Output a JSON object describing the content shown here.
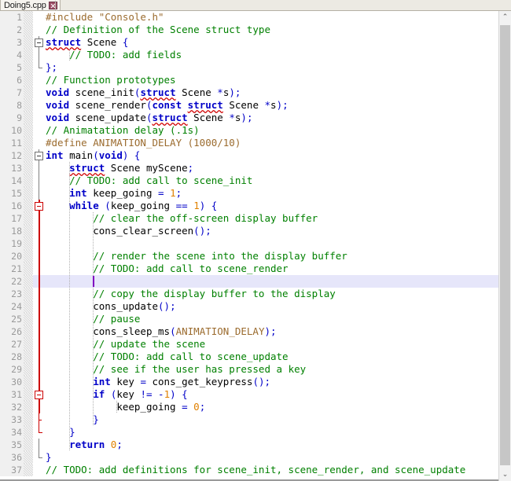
{
  "window": {
    "tab_label": "Doing5.cpp",
    "tab_icon": "close-icon"
  },
  "scrollbar": {
    "up_arrow": "⌃",
    "down_arrow": "⌄"
  },
  "editor": {
    "filename": "Doing5.cpp",
    "language": "C++",
    "current_line": 22,
    "total_lines": 37,
    "colors": {
      "keyword": "#0000c8",
      "comment": "#008000",
      "preprocessor": "#9b6b2e",
      "number": "#e08000",
      "current_line_bg": "#e6e6fa",
      "gutter_bg": "#f0f0f0",
      "fold_active": "#cc0000",
      "caret": "#8000c0"
    },
    "lines": [
      {
        "n": 1,
        "text": "#include \"Console.h\""
      },
      {
        "n": 2,
        "text": "// Definition of the Scene struct type"
      },
      {
        "n": 3,
        "text": "struct Scene {"
      },
      {
        "n": 4,
        "text": "    // TODO: add fields"
      },
      {
        "n": 5,
        "text": "};"
      },
      {
        "n": 6,
        "text": "// Function prototypes"
      },
      {
        "n": 7,
        "text": "void scene_init(struct Scene *s);"
      },
      {
        "n": 8,
        "text": "void scene_render(const struct Scene *s);"
      },
      {
        "n": 9,
        "text": "void scene_update(struct Scene *s);"
      },
      {
        "n": 10,
        "text": "// Animatation delay (.1s)"
      },
      {
        "n": 11,
        "text": "#define ANIMATION_DELAY (1000/10)"
      },
      {
        "n": 12,
        "text": "int main(void) {"
      },
      {
        "n": 13,
        "text": "    struct Scene myScene;"
      },
      {
        "n": 14,
        "text": "    // TODO: add call to scene_init"
      },
      {
        "n": 15,
        "text": "    int keep_going = 1;"
      },
      {
        "n": 16,
        "text": "    while (keep_going == 1) {"
      },
      {
        "n": 17,
        "text": "        // clear the off-screen display buffer"
      },
      {
        "n": 18,
        "text": "        cons_clear_screen();"
      },
      {
        "n": 19,
        "text": ""
      },
      {
        "n": 20,
        "text": "        // render the scene into the display buffer"
      },
      {
        "n": 21,
        "text": "        // TODO: add call to scene_render"
      },
      {
        "n": 22,
        "text": ""
      },
      {
        "n": 23,
        "text": "        // copy the display buffer to the display"
      },
      {
        "n": 24,
        "text": "        cons_update();"
      },
      {
        "n": 25,
        "text": "        // pause"
      },
      {
        "n": 26,
        "text": "        cons_sleep_ms(ANIMATION_DELAY);"
      },
      {
        "n": 27,
        "text": "        // update the scene"
      },
      {
        "n": 28,
        "text": "        // TODO: add call to scene_update"
      },
      {
        "n": 29,
        "text": "        // see if the user has pressed a key"
      },
      {
        "n": 30,
        "text": "        int key = cons_get_keypress();"
      },
      {
        "n": 31,
        "text": "        if (key != -1) {"
      },
      {
        "n": 32,
        "text": "            keep_going = 0;"
      },
      {
        "n": 33,
        "text": "        }"
      },
      {
        "n": 34,
        "text": "    }"
      },
      {
        "n": 35,
        "text": "    return 0;"
      },
      {
        "n": 36,
        "text": "}"
      },
      {
        "n": 37,
        "text": "// TODO: add definitions for scene_init, scene_render, and scene_update"
      }
    ],
    "spellcheck_words": [
      "struct",
      "Animatation"
    ],
    "fold_boxes": [
      3,
      12,
      16,
      31
    ]
  }
}
